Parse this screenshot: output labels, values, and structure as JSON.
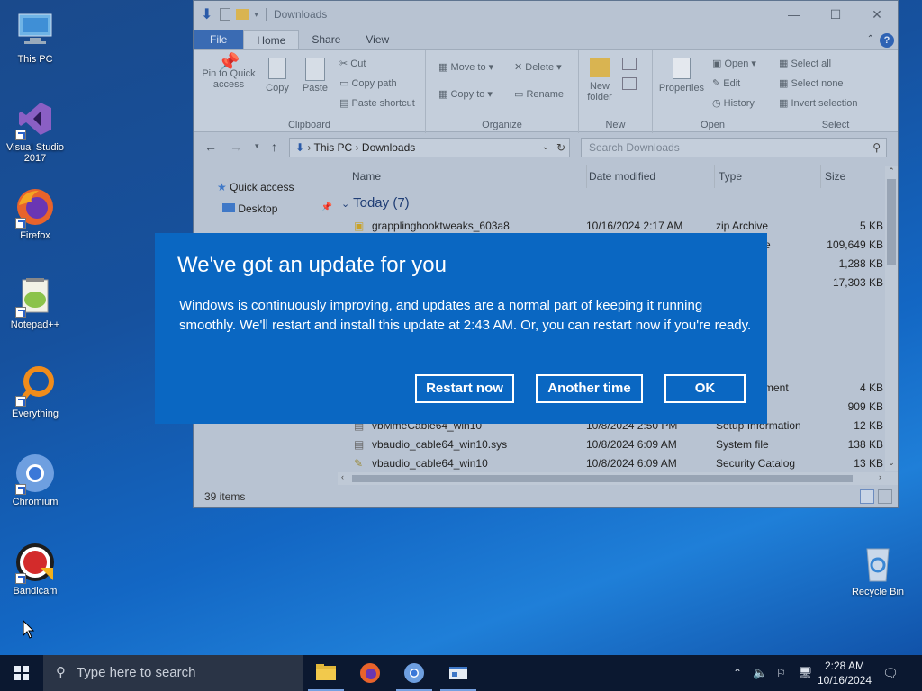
{
  "desktop": {
    "icons": [
      {
        "label": "This PC",
        "icon": "this-pc-icon"
      },
      {
        "label": "Visual Studio 2017",
        "icon": "visual-studio-icon"
      },
      {
        "label": "Firefox",
        "icon": "firefox-icon"
      },
      {
        "label": "Notepad++",
        "icon": "notepadpp-icon"
      },
      {
        "label": "Everything",
        "icon": "everything-icon"
      },
      {
        "label": "Chromium",
        "icon": "chromium-icon"
      },
      {
        "label": "Bandicam",
        "icon": "bandicam-icon"
      },
      {
        "label": "Recycle Bin",
        "icon": "recycle-bin-icon"
      }
    ]
  },
  "explorer": {
    "title": "Downloads",
    "tabs": [
      "File",
      "Home",
      "Share",
      "View"
    ],
    "ribbon": {
      "clipboard": {
        "pin": "Pin to Quick access",
        "copy": "Copy",
        "paste": "Paste",
        "cut": "Cut",
        "copy_path": "Copy path",
        "paste_shortcut": "Paste shortcut",
        "label": "Clipboard"
      },
      "organize": {
        "move_to": "Move to",
        "copy_to": "Copy to",
        "delete": "Delete",
        "rename": "Rename",
        "label": "Organize"
      },
      "new": {
        "new_folder": "New folder",
        "label": "New"
      },
      "open": {
        "properties": "Properties",
        "open": "Open",
        "edit": "Edit",
        "history": "History",
        "label": "Open"
      },
      "select": {
        "select_all": "Select all",
        "select_none": "Select none",
        "invert": "Invert selection",
        "label": "Select"
      }
    },
    "address": {
      "crumbs": [
        "This PC",
        "Downloads"
      ],
      "search_placeholder": "Search Downloads"
    },
    "nav": [
      {
        "label": "Quick access"
      },
      {
        "label": "Desktop"
      }
    ],
    "columns": {
      "name": "Name",
      "date": "Date modified",
      "type": "Type",
      "size": "Size"
    },
    "group": "Today (7)",
    "rows": [
      {
        "name": "grapplinghooktweaks_603a8",
        "date": "10/16/2024 2:17 AM",
        "type": "zip Archive",
        "size": "5 KB"
      },
      {
        "name": "",
        "date": "",
        "type": "e",
        "size": "109,649 KB"
      },
      {
        "name": "",
        "date": "",
        "type": "",
        "size": "1,288 KB"
      },
      {
        "name": "",
        "date": "",
        "type": "",
        "size": "17,303 KB"
      },
      {
        "name": "",
        "date": "",
        "type": "ment",
        "size": "4 KB"
      },
      {
        "name": "",
        "date": "",
        "type": "",
        "size": "909 KB"
      },
      {
        "name": "vbMmeCable64_win10",
        "date": "10/8/2024 2:50 PM",
        "type": "Setup Information",
        "size": "12 KB"
      },
      {
        "name": "vbaudio_cable64_win10.sys",
        "date": "10/8/2024 6:09 AM",
        "type": "System file",
        "size": "138 KB"
      },
      {
        "name": "vbaudio_cable64_win10",
        "date": "10/8/2024 6:09 AM",
        "type": "Security Catalog",
        "size": "13 KB"
      }
    ],
    "status": "39 items"
  },
  "dialog": {
    "title": "We've got an update for you",
    "body": "Windows is continuously improving, and updates are a normal part of keeping it running smoothly. We'll restart and install this update at 2:43 AM. Or, you can restart now if you're ready.",
    "buttons": {
      "restart": "Restart now",
      "another": "Another time",
      "ok": "OK"
    }
  },
  "taskbar": {
    "search_placeholder": "Type here to search",
    "time": "2:28 AM",
    "date": "10/16/2024"
  }
}
